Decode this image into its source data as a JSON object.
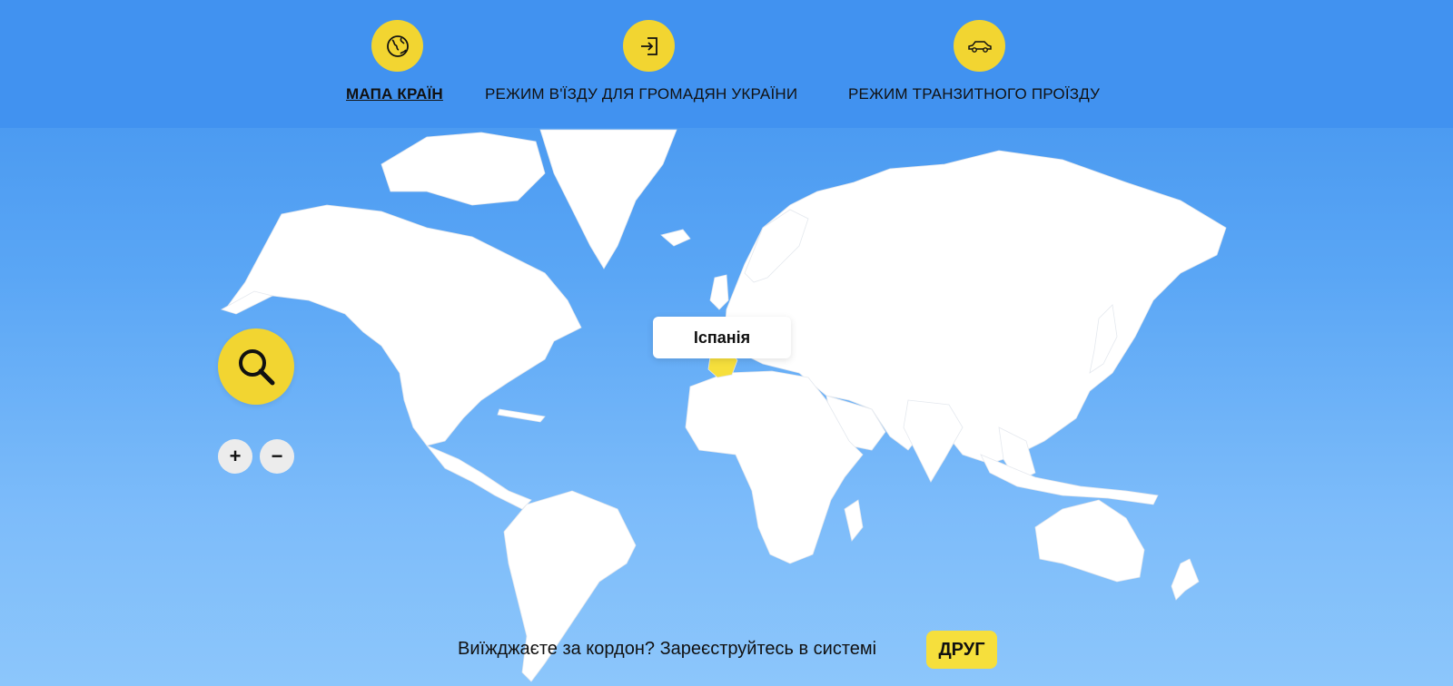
{
  "nav": {
    "items": [
      {
        "label": "МАПА КРАЇН",
        "icon": "globe-icon",
        "active": true
      },
      {
        "label": "РЕЖИМ В'ЇЗДУ ДЛЯ ГРОМАДЯН УКРАЇНИ",
        "icon": "sign-in-icon",
        "active": false
      },
      {
        "label": "РЕЖИМ ТРАНЗИТНОГО ПРОЇЗДУ",
        "icon": "car-icon",
        "active": false
      }
    ]
  },
  "map": {
    "tooltip": "Іспанія",
    "highlight_color": "#f6df3c",
    "land_color": "#ffffff",
    "zoom_in_label": "+",
    "zoom_out_label": "−"
  },
  "footer": {
    "text": "Виїжджаєте за кордон? Зареєструйтесь в системі",
    "button_label": "ДРУГ"
  },
  "colors": {
    "accent": "#f2d531",
    "header_bg": "#4192f0"
  }
}
